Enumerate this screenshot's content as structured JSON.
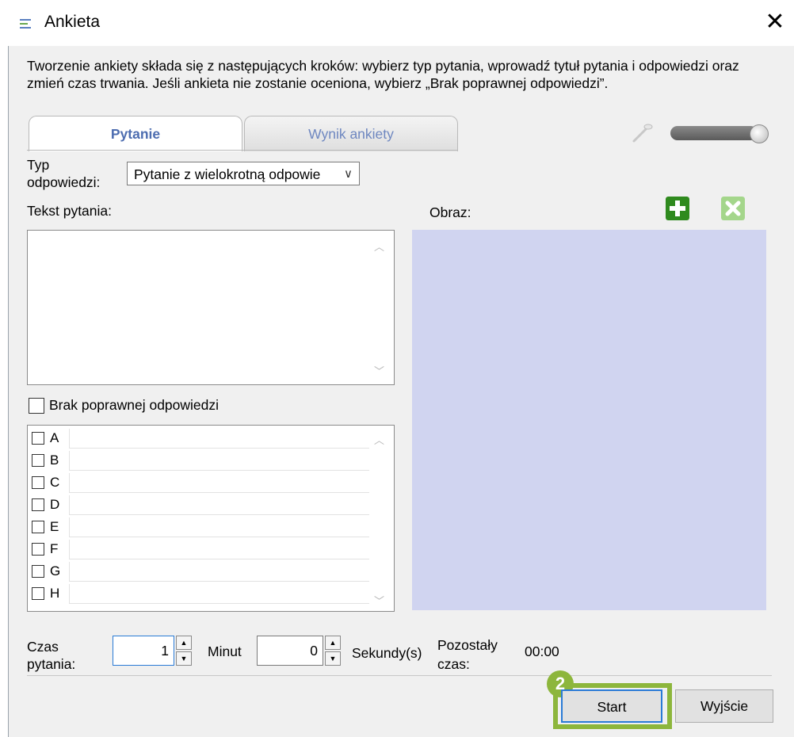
{
  "window": {
    "title": "Ankieta",
    "close_glyph": "✕"
  },
  "intro_text": "Tworzenie ankiety składa się z następujących kroków: wybierz typ pytania, wprowadź tytuł pytania i odpowiedzi oraz zmień czas trwania. Jeśli ankieta nie zostanie oceniona, wybierz „Brak poprawnej odpowiedzi”.",
  "tabs": [
    {
      "label": "Pytanie",
      "active": true
    },
    {
      "label": "Wynik ankiety",
      "active": false
    }
  ],
  "answer_type": {
    "label_line1": "Typ",
    "label_line2": "odpowiedzi:",
    "selected": "Pytanie z wielokrotną odpowie"
  },
  "question_text": {
    "label": "Tekst pytania:",
    "value": ""
  },
  "image": {
    "label": "Obraz:",
    "add_icon": "plus-icon",
    "remove_icon": "x-icon",
    "area_color": "#d0d4f0"
  },
  "no_correct": {
    "label": "Brak poprawnej odpowiedzi",
    "checked": false
  },
  "answers": [
    {
      "letter": "A",
      "value": "",
      "checked": false
    },
    {
      "letter": "B",
      "value": "",
      "checked": false
    },
    {
      "letter": "C",
      "value": "",
      "checked": false
    },
    {
      "letter": "D",
      "value": "",
      "checked": false
    },
    {
      "letter": "E",
      "value": "",
      "checked": false
    },
    {
      "letter": "F",
      "value": "",
      "checked": false
    },
    {
      "letter": "G",
      "value": "",
      "checked": false
    },
    {
      "letter": "H",
      "value": "",
      "checked": false
    }
  ],
  "time": {
    "label_line1": "Czas",
    "label_line2": "pytania:",
    "minutes": "1",
    "minutes_unit": "Minut",
    "seconds": "0",
    "seconds_unit": "Sekundy(s)",
    "remaining_line1": "Pozostały",
    "remaining_line2": "czas:",
    "remaining_value": "00:00"
  },
  "buttons": {
    "start": "Start",
    "exit": "Wyjście"
  },
  "callout": {
    "number": "2",
    "color": "#8db63c"
  },
  "colors": {
    "accent": "#4d6db0",
    "add_green": "#2f8a1e",
    "remove_green": "#a4d68b"
  }
}
